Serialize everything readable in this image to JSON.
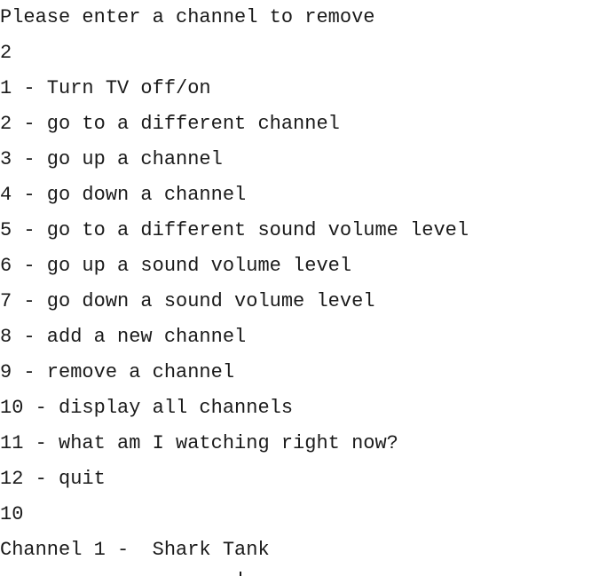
{
  "console": {
    "prompt": "Please enter a channel to remove",
    "input_1": "2",
    "menu": [
      "1 - Turn TV off/on",
      "2 - go to a different channel",
      "3 - go up a channel",
      "4 - go down a channel",
      "5 - go to a different sound volume level",
      "6 - go up a sound volume level",
      "7 - go down a sound volume level",
      "8 - add a new channel",
      "9 - remove a channel",
      "10 - display all channels",
      "11 - what am I watching right now?",
      "12 - quit"
    ],
    "input_2": "10",
    "output": "Channel 1 -  Shark Tank"
  }
}
